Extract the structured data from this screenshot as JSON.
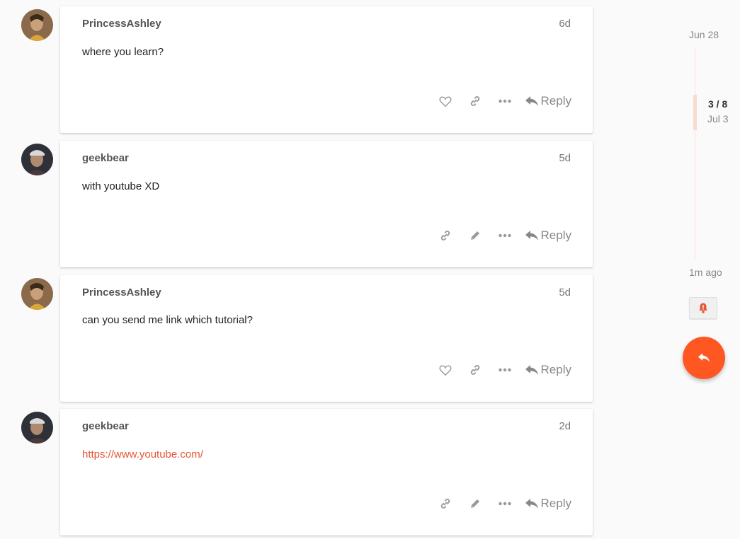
{
  "posts": [
    {
      "username": "PrincessAshley",
      "age": "6d",
      "text": "where you learn?",
      "is_link": false,
      "own": false,
      "reply_label": "Reply",
      "avatar": "avatar-princessashley"
    },
    {
      "username": "geekbear",
      "age": "5d",
      "text": "with youtube XD",
      "is_link": false,
      "own": true,
      "reply_label": "Reply",
      "avatar": "avatar-geekbear"
    },
    {
      "username": "PrincessAshley",
      "age": "5d",
      "text": "can you send me link which tutorial?",
      "is_link": false,
      "own": false,
      "reply_label": "Reply",
      "avatar": "avatar-princessashley"
    },
    {
      "username": "geekbear",
      "age": "2d",
      "text": "https://www.youtube.com/",
      "is_link": true,
      "own": true,
      "reply_label": "Reply",
      "avatar": "avatar-geekbear"
    }
  ],
  "timeline": {
    "start_date": "Jun 28",
    "position": "3 / 8",
    "current_date": "Jul 3",
    "end_label": "1m ago"
  },
  "icons": {
    "like": "heart-icon",
    "link": "link-icon",
    "edit": "pencil-icon",
    "more": "more-icon",
    "reply": "reply-icon",
    "notification": "bell-icon",
    "fab": "reply-icon"
  },
  "colors": {
    "accent": "#e45735",
    "fab": "#fe5722",
    "timeline_track": "#fde3da"
  }
}
